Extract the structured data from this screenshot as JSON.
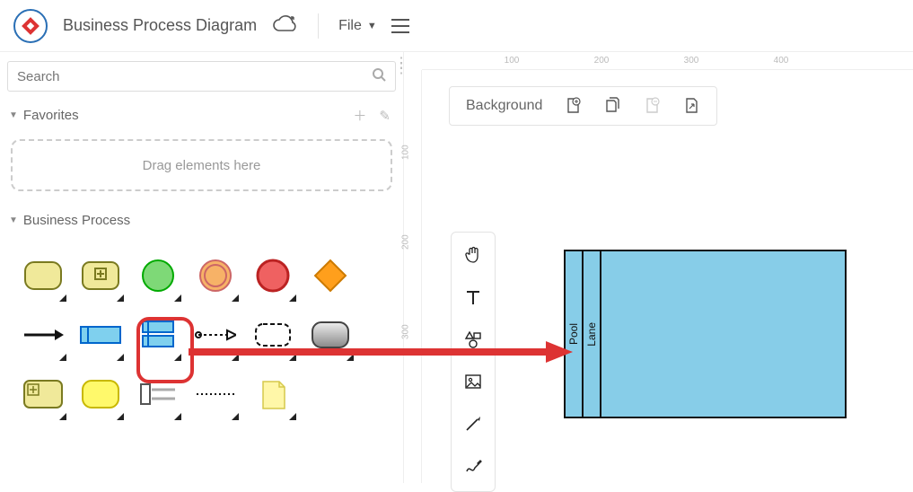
{
  "header": {
    "doc_title": "Business Process Diagram",
    "file_label": "File"
  },
  "sidebar": {
    "search_placeholder": "Search",
    "favorites_label": "Favorites",
    "drop_hint": "Drag elements here",
    "bp_label": "Business Process",
    "shapes": [
      {
        "name": "task-shape",
        "corner": true
      },
      {
        "name": "subprocess-shape",
        "corner": true
      },
      {
        "name": "start-event-shape",
        "corner": true
      },
      {
        "name": "intermediate-event-shape",
        "corner": true
      },
      {
        "name": "end-event-shape",
        "corner": true
      },
      {
        "name": "gateway-shape",
        "corner": false
      },
      {
        "name": "sequence-flow-shape",
        "corner": true
      },
      {
        "name": "pool-horizontal-shape",
        "corner": true
      },
      {
        "name": "pool-vertical-shape",
        "corner": true
      },
      {
        "name": "message-flow-shape",
        "corner": true
      },
      {
        "name": "group-shape",
        "corner": true
      },
      {
        "name": "data-object-shape",
        "corner": true
      },
      {
        "name": "call-activity-shape",
        "corner": true
      },
      {
        "name": "call-activity-yellow-shape",
        "corner": true
      },
      {
        "name": "lane-shape",
        "corner": true
      },
      {
        "name": "association-shape",
        "corner": true
      },
      {
        "name": "annotation-shape",
        "corner": true
      }
    ]
  },
  "canvas": {
    "background_label": "Background",
    "ruler_h": [
      "100",
      "200",
      "300",
      "400"
    ],
    "ruler_v": [
      "100",
      "200",
      "300"
    ],
    "pool_label": "Pool",
    "lane_label": "Lane"
  }
}
